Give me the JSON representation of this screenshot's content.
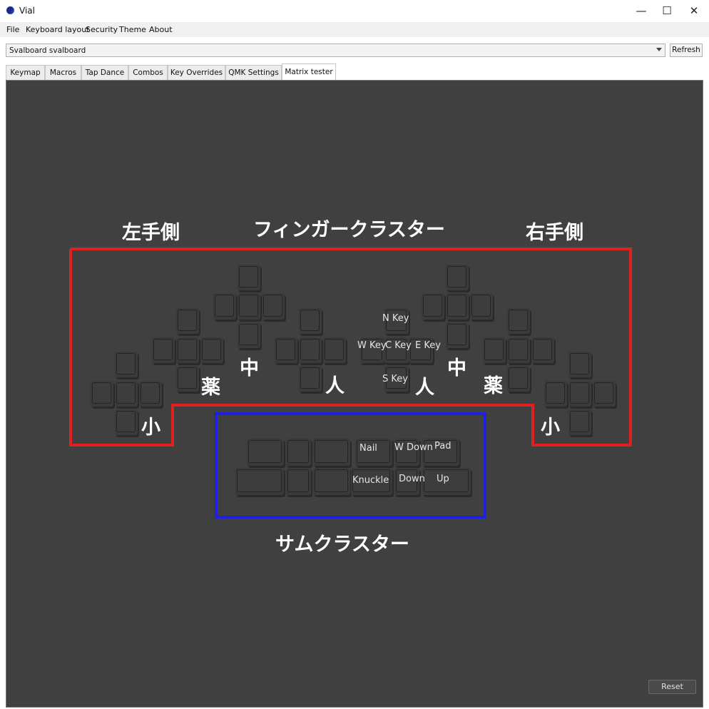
{
  "window": {
    "title": "Vial",
    "minimize": "—",
    "maximize": "☐",
    "close": "✕"
  },
  "menu": [
    "File",
    "Keyboard layout",
    "Security",
    "Theme",
    "About"
  ],
  "keyboard_selector": {
    "value": "Svalboard svalboard",
    "refresh_label": "Refresh"
  },
  "tabs": [
    "Keymap",
    "Macros",
    "Tap Dance",
    "Combos",
    "Key Overrides",
    "QMK Settings",
    "Matrix tester"
  ],
  "active_tab": "Matrix tester",
  "key_labels": {
    "n_key": "N Key",
    "w_key": "W Key",
    "c_key": "C Key",
    "e_key": "E Key",
    "s_key": "S Key",
    "nail": "Nail",
    "w_down": "W Down",
    "pad": "Pad",
    "knuckle": "Knuckle",
    "down": "Down",
    "up": "Up"
  },
  "annotations": {
    "left_side": "左手側",
    "finger_cluster": "フィンガークラスター",
    "right_side": "右手側",
    "thumb_cluster": "サムクラスター",
    "middle": "中",
    "ring": "薬",
    "index": "人",
    "pinky": "小"
  },
  "colors": {
    "finger_outline": "#e02020",
    "thumb_outline": "#2020e0",
    "panel_bg": "#404040"
  },
  "reset_label": "Reset"
}
